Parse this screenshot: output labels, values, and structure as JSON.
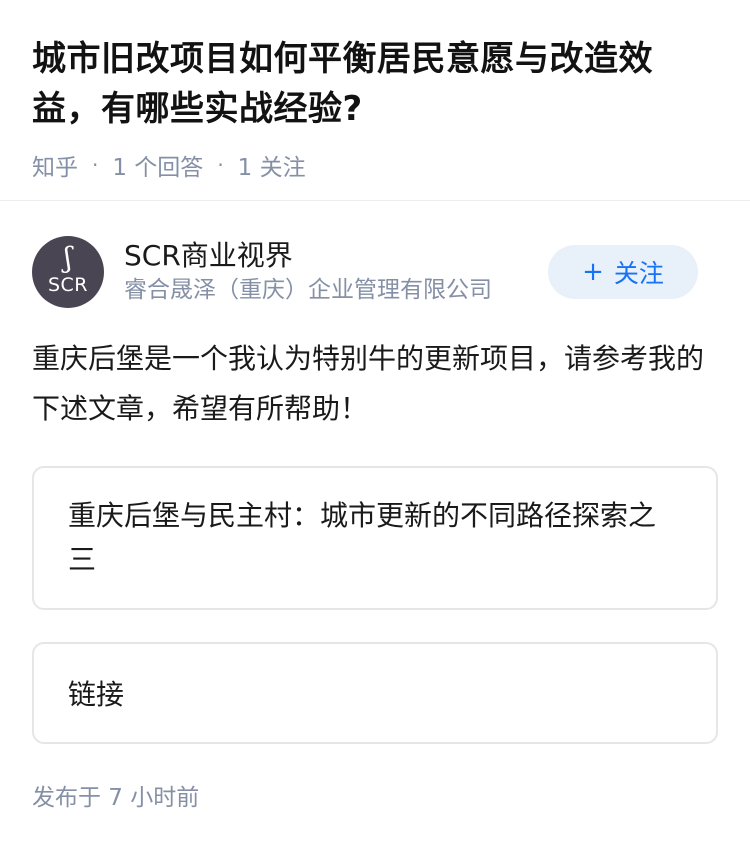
{
  "question": {
    "title": "城市旧改项目如何平衡居民意愿与改造效益，有哪些实战经验?",
    "source": "知乎",
    "answers": "1 个回答",
    "followers": "1 关注",
    "separator": "·"
  },
  "author": {
    "avatar_glyph": "ʃ",
    "avatar_initials": "SCR",
    "name": "SCR商业视界",
    "description": "睿合晟泽（重庆）企业管理有限公司",
    "follow_icon": "+",
    "follow_label": "关注"
  },
  "answer": {
    "text": "重庆后堡是一个我认为特别牛的更新项目，请参考我的下述文章，希望有所帮助！",
    "article_card_title": "重庆后堡与民主村：城市更新的不同路径探索之三",
    "link_card_label": "链接",
    "published": "发布于 7 小时前"
  },
  "colors": {
    "meta_gray": "#8590a6",
    "accent_blue": "#1772f6",
    "follow_bg": "#e8f0fa",
    "avatar_bg": "#4a4553"
  }
}
